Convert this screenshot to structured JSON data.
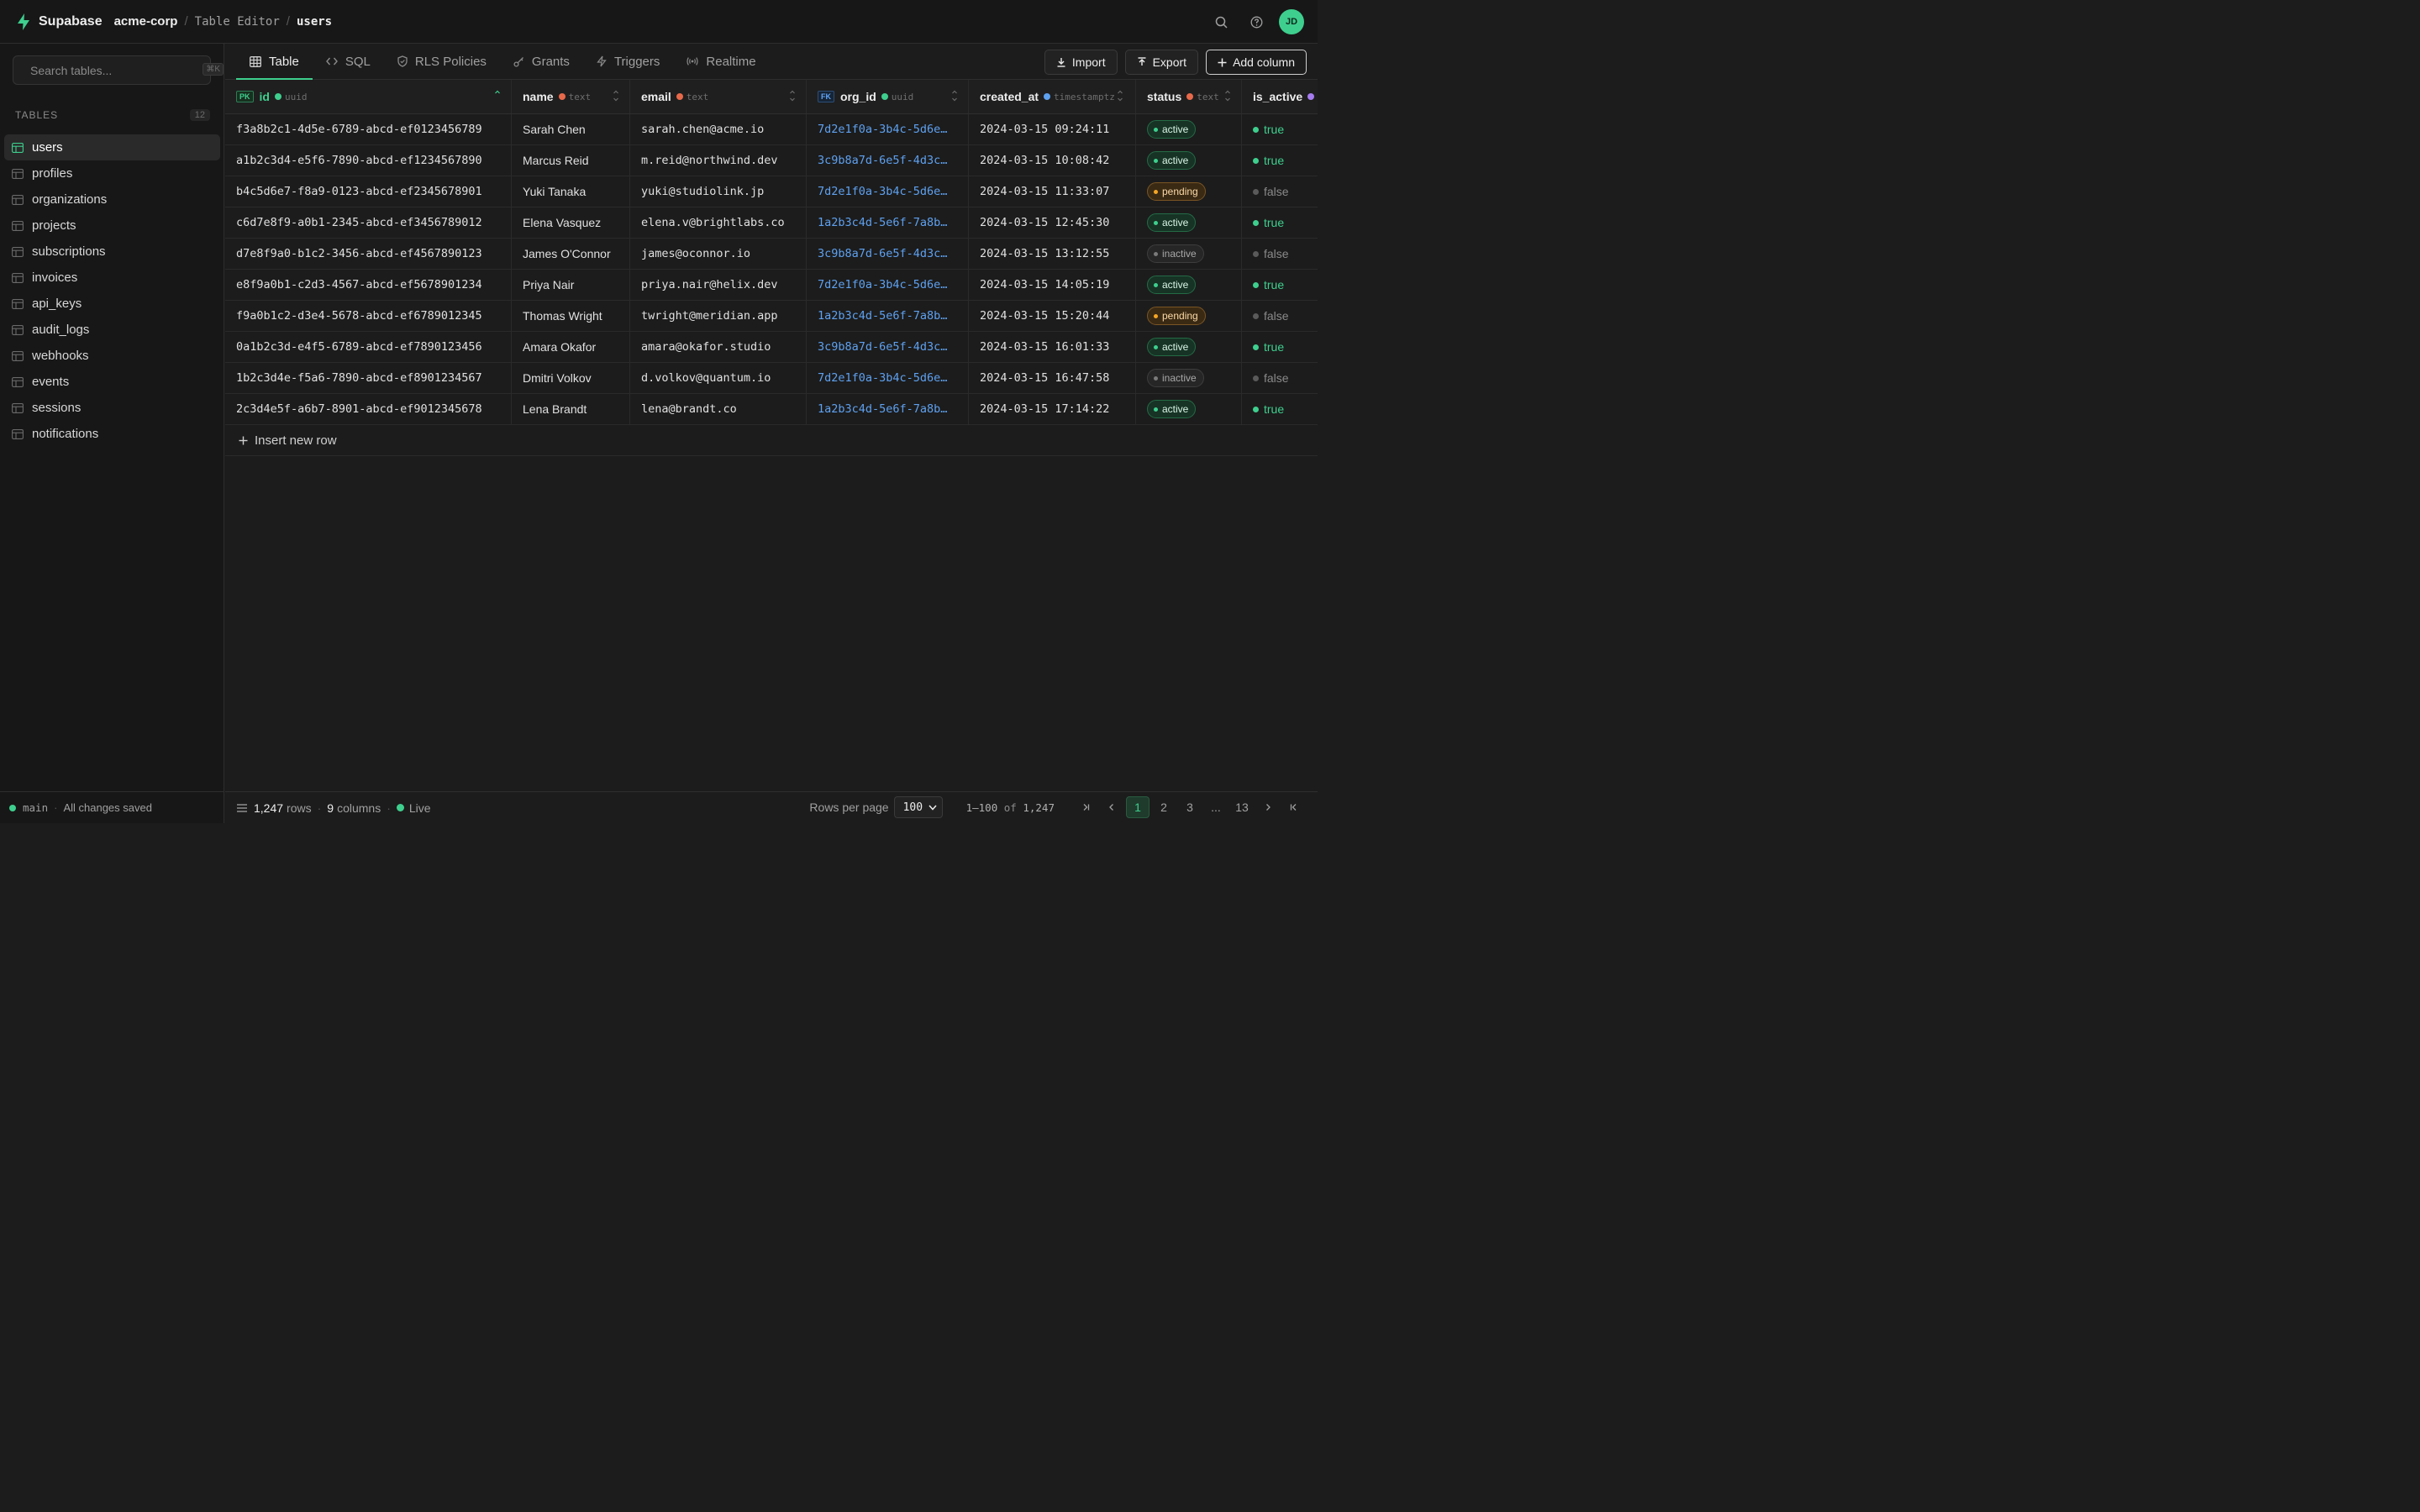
{
  "brand": {
    "name": "Supabase"
  },
  "breadcrumb": {
    "project": "acme-corp",
    "section": "Table Editor",
    "current": "users"
  },
  "user": {
    "initials": "JD"
  },
  "sidebar": {
    "search_placeholder": "Search tables...",
    "shortcut": "⌘K",
    "tables_label": "TABLES",
    "tables_count": "12",
    "items": [
      {
        "label": "users",
        "active": true
      },
      {
        "label": "profiles"
      },
      {
        "label": "organizations"
      },
      {
        "label": "projects"
      },
      {
        "label": "subscriptions"
      },
      {
        "label": "invoices"
      },
      {
        "label": "api_keys"
      },
      {
        "label": "audit_logs"
      },
      {
        "label": "webhooks"
      },
      {
        "label": "events"
      },
      {
        "label": "sessions"
      },
      {
        "label": "notifications"
      }
    ],
    "footer": {
      "branch": "main",
      "status": "All changes saved"
    }
  },
  "tabs": [
    {
      "label": "Table",
      "icon": "table-icon"
    },
    {
      "label": "SQL",
      "icon": "code-icon"
    },
    {
      "label": "RLS Policies",
      "icon": "shield-icon"
    },
    {
      "label": "Grants",
      "icon": "key-icon"
    },
    {
      "label": "Triggers",
      "icon": "bolt-icon"
    },
    {
      "label": "Realtime",
      "icon": "broadcast-icon"
    }
  ],
  "actions": {
    "import": "Import",
    "export": "Export",
    "add_column": "Add column"
  },
  "columns": {
    "id": {
      "name": "id",
      "type": "uuid",
      "key": "PK"
    },
    "name": {
      "name": "name",
      "type": "text"
    },
    "email": {
      "name": "email",
      "type": "text"
    },
    "org_id": {
      "name": "org_id",
      "type": "uuid",
      "key": "FK"
    },
    "created_at": {
      "name": "created_at",
      "type": "timestamptz"
    },
    "status": {
      "name": "status",
      "type": "text"
    },
    "is_active": {
      "name": "is_active"
    }
  },
  "rows": [
    {
      "id": "f3a8b2c1-4d5e-6789-abcd-ef0123456789",
      "name": "Sarah Chen",
      "email": "sarah.chen@acme.io",
      "org_id": "7d2e1f0a-3b4c-5d6e…",
      "created_at": "2024-03-15 09:24:11",
      "status": "active",
      "is_active": "true"
    },
    {
      "id": "a1b2c3d4-e5f6-7890-abcd-ef1234567890",
      "name": "Marcus Reid",
      "email": "m.reid@northwind.dev",
      "org_id": "3c9b8a7d-6e5f-4d3c…",
      "created_at": "2024-03-15 10:08:42",
      "status": "active",
      "is_active": "true"
    },
    {
      "id": "b4c5d6e7-f8a9-0123-abcd-ef2345678901",
      "name": "Yuki Tanaka",
      "email": "yuki@studiolink.jp",
      "org_id": "7d2e1f0a-3b4c-5d6e…",
      "created_at": "2024-03-15 11:33:07",
      "status": "pending",
      "is_active": "false"
    },
    {
      "id": "c6d7e8f9-a0b1-2345-abcd-ef3456789012",
      "name": "Elena Vasquez",
      "email": "elena.v@brightlabs.co",
      "org_id": "1a2b3c4d-5e6f-7a8b…",
      "created_at": "2024-03-15 12:45:30",
      "status": "active",
      "is_active": "true"
    },
    {
      "id": "d7e8f9a0-b1c2-3456-abcd-ef4567890123",
      "name": "James O'Connor",
      "email": "james@oconnor.io",
      "org_id": "3c9b8a7d-6e5f-4d3c…",
      "created_at": "2024-03-15 13:12:55",
      "status": "inactive",
      "is_active": "false"
    },
    {
      "id": "e8f9a0b1-c2d3-4567-abcd-ef5678901234",
      "name": "Priya Nair",
      "email": "priya.nair@helix.dev",
      "org_id": "7d2e1f0a-3b4c-5d6e…",
      "created_at": "2024-03-15 14:05:19",
      "status": "active",
      "is_active": "true"
    },
    {
      "id": "f9a0b1c2-d3e4-5678-abcd-ef6789012345",
      "name": "Thomas Wright",
      "email": "twright@meridian.app",
      "org_id": "1a2b3c4d-5e6f-7a8b…",
      "created_at": "2024-03-15 15:20:44",
      "status": "pending",
      "is_active": "false"
    },
    {
      "id": "0a1b2c3d-e4f5-6789-abcd-ef7890123456",
      "name": "Amara Okafor",
      "email": "amara@okafor.studio",
      "org_id": "3c9b8a7d-6e5f-4d3c…",
      "created_at": "2024-03-15 16:01:33",
      "status": "active",
      "is_active": "true"
    },
    {
      "id": "1b2c3d4e-f5a6-7890-abcd-ef8901234567",
      "name": "Dmitri Volkov",
      "email": "d.volkov@quantum.io",
      "org_id": "7d2e1f0a-3b4c-5d6e…",
      "created_at": "2024-03-15 16:47:58",
      "status": "inactive",
      "is_active": "false"
    },
    {
      "id": "2c3d4e5f-a6b7-8901-abcd-ef9012345678",
      "name": "Lena Brandt",
      "email": "lena@brandt.co",
      "org_id": "1a2b3c4d-5e6f-7a8b…",
      "created_at": "2024-03-15 17:14:22",
      "status": "active",
      "is_active": "true"
    }
  ],
  "insert_row": "Insert new row",
  "footer": {
    "rows_count": "1,247",
    "rows_label": "rows",
    "columns_count": "9",
    "columns_label": "columns",
    "live": "Live",
    "rows_per_page_label": "Rows per page",
    "rows_per_page": "100",
    "range": "1–100",
    "range_of": "of",
    "total": "1,247",
    "pages": [
      "1",
      "2",
      "3",
      "...",
      "13"
    ],
    "current_page": "1"
  },
  "colors": {
    "accent": "#3ecf8e",
    "link": "#5ea1f0",
    "pending": "#f5a524"
  }
}
